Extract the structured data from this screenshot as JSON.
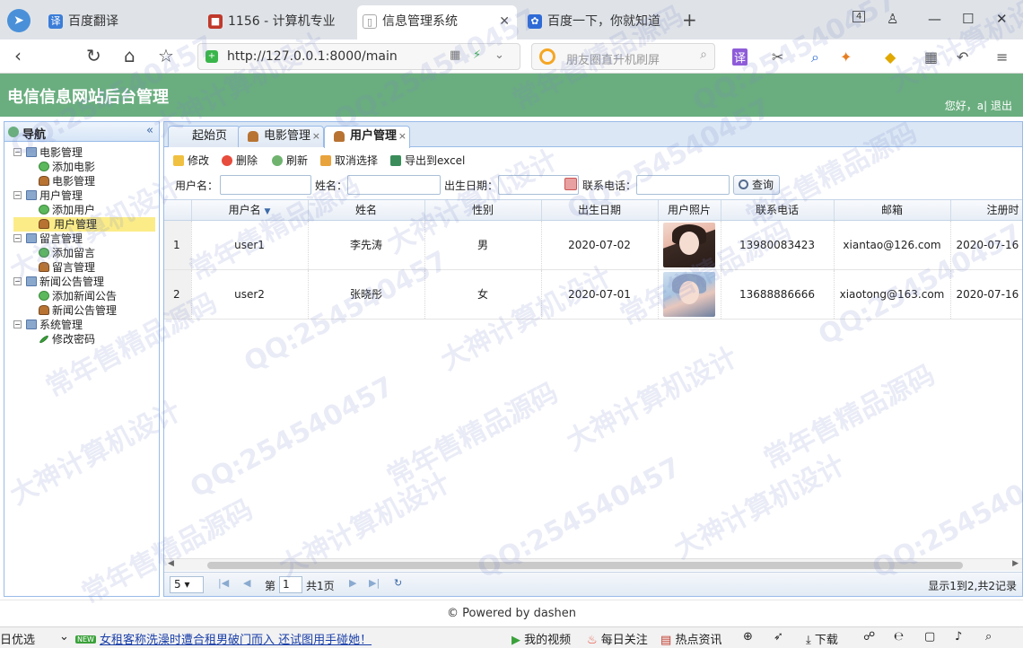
{
  "browser": {
    "tabs": [
      {
        "label": "百度翻译",
        "icon": "translate-icon",
        "color": "#3b7dd8"
      },
      {
        "label": "1156 - 计算机专业",
        "icon": "site-icon",
        "color": "#c0392b"
      },
      {
        "label": "信息管理系统",
        "icon": "page-icon",
        "color": "#888888"
      },
      {
        "label": "百度一下，你就知道",
        "icon": "paw-icon",
        "color": "#2e6bd6"
      }
    ],
    "tab_count": "4",
    "url": "http://127.0.0.1:8000/main",
    "search_placeholder": "朋友圈直升机刷屏"
  },
  "app": {
    "title": "电信信息网站后台管理",
    "user_greeting": "您好，a| 退出",
    "accent_color": "#6aae7f"
  },
  "nav": {
    "title": "导航",
    "collapse": "«",
    "tree": [
      {
        "label": "电影管理",
        "children": [
          {
            "label": "添加电影",
            "icon": "add"
          },
          {
            "label": "电影管理",
            "icon": "person"
          }
        ]
      },
      {
        "label": "用户管理",
        "children": [
          {
            "label": "添加用户",
            "icon": "add"
          },
          {
            "label": "用户管理",
            "icon": "person",
            "selected": true
          }
        ]
      },
      {
        "label": "留言管理",
        "children": [
          {
            "label": "添加留言",
            "icon": "add"
          },
          {
            "label": "留言管理",
            "icon": "person"
          }
        ]
      },
      {
        "label": "新闻公告管理",
        "children": [
          {
            "label": "添加新闻公告",
            "icon": "add"
          },
          {
            "label": "新闻公告管理",
            "icon": "person"
          }
        ]
      },
      {
        "label": "系统管理",
        "children": [
          {
            "label": "修改密码",
            "icon": "pencil"
          }
        ]
      }
    ]
  },
  "content_tabs": [
    {
      "label": "起始页",
      "closable": false
    },
    {
      "label": "电影管理",
      "closable": true
    },
    {
      "label": "用户管理",
      "closable": true,
      "active": true
    }
  ],
  "toolbar": {
    "edit": "修改",
    "delete": "删除",
    "refresh": "刷新",
    "unselect": "取消选择",
    "export": "导出到excel"
  },
  "filter": {
    "username_label": "用户名：",
    "name_label": "姓名：",
    "birth_label": "出生日期：",
    "phone_label": "联系电话：",
    "query_button": "查询"
  },
  "grid": {
    "columns": [
      "用户名",
      "姓名",
      "性别",
      "出生日期",
      "用户照片",
      "联系电话",
      "邮箱",
      "注册时"
    ],
    "rows": [
      {
        "rn": "1",
        "username": "user1",
        "name": "李先涛",
        "gender": "男",
        "birth": "2020-07-02",
        "phone": "13980083423",
        "email": "xiantao@126.com",
        "regdate": "2020-07-16"
      },
      {
        "rn": "2",
        "username": "user2",
        "name": "张晓彤",
        "gender": "女",
        "birth": "2020-07-01",
        "phone": "13688886666",
        "email": "xiaotong@163.com",
        "regdate": "2020-07-16"
      }
    ]
  },
  "pager": {
    "page_size": "5",
    "page_prefix": "第",
    "page_value": "1",
    "page_suffix": "共1页",
    "info": "显示1到2,共2记录"
  },
  "footer": "© Powered by dashen",
  "statusbar": {
    "left": "日优选",
    "badge": "NEW",
    "news": "女租客称洗澡时遭合租男破门而入 还试图用手碰她！",
    "video": "我的视频",
    "daily": "每日关注",
    "hot": "热点资讯",
    "download": "下载"
  },
  "watermarks": [
    "QQ:254540457",
    "大神计算机设计",
    "常年售精品源码"
  ]
}
